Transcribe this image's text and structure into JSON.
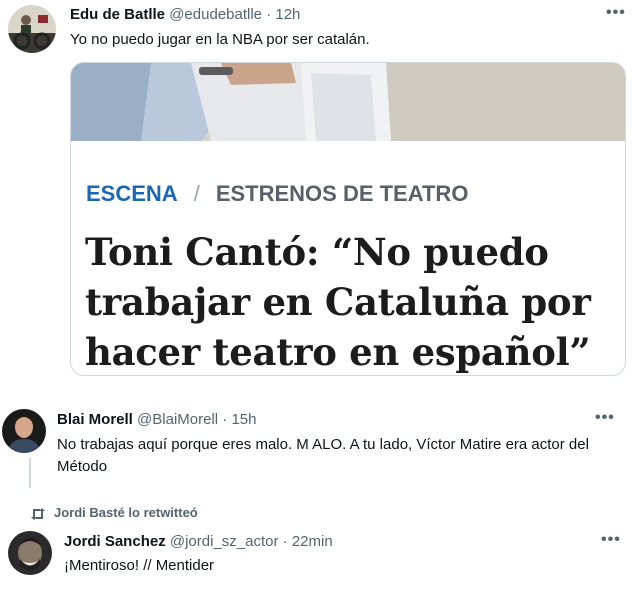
{
  "tweets": [
    {
      "name": "Edu de Batlle",
      "handle": "@edudebatlle",
      "time": "· 12h",
      "text": "Yo no puedo jugar en la NBA por ser catalán.",
      "more_icon": "•••",
      "card": {
        "section": "ESCENA",
        "separator": "/",
        "subsection": "ESTRENOS DE TEATRO",
        "headline": "Toni Cantó: “No puedo trabajar en Cataluña por hacer teatro en español”"
      }
    },
    {
      "name": "Blai Morell",
      "handle": "@BlaiMorell",
      "time": "· 15h",
      "text": "No trabajas aquí porque eres malo. M ALO. A tu lado, Víctor Matire era actor del Método",
      "more_icon": "•••"
    },
    {
      "retweet_label": "Jordi Basté lo retwitteó",
      "name": "Jordi Sanchez",
      "handle": "@jordi_sz_actor",
      "time": "· 22min",
      "text": "¡Mentiroso! // Mentider",
      "more_icon": "•••"
    }
  ],
  "colors": {
    "section": "#1a67b8",
    "muted": "#536471",
    "border": "#cfd9de"
  },
  "icons": [
    "more-icon",
    "retweet-icon"
  ]
}
